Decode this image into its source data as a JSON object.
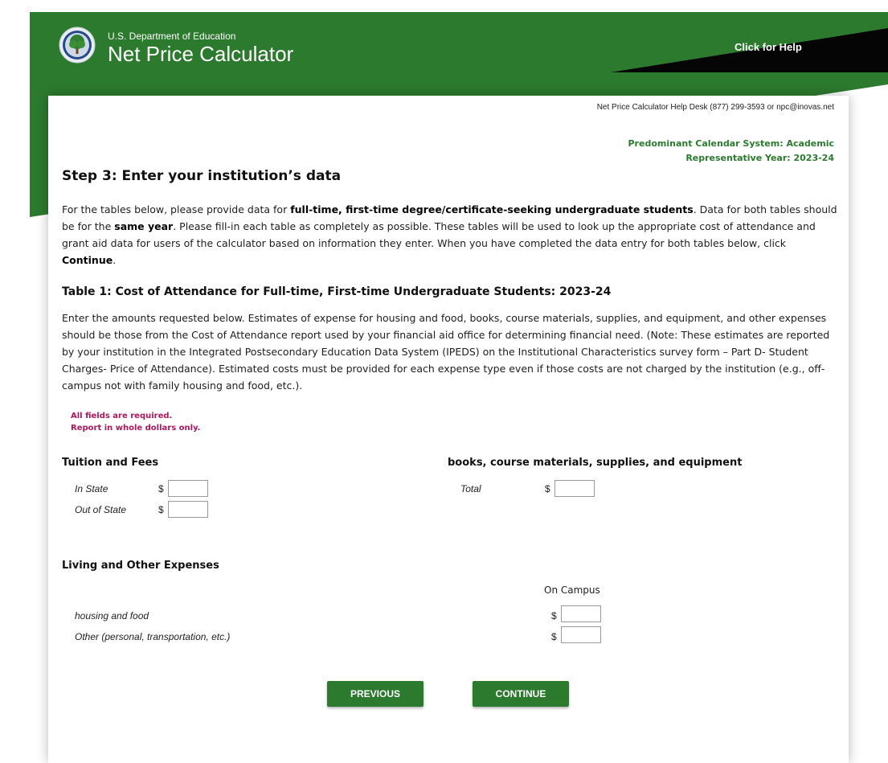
{
  "header": {
    "department": "U.S. Department of Education",
    "title": "Net Price Calculator",
    "help_link": "Click for Help"
  },
  "help_desk": "Net Price Calculator Help Desk (877) 299-3593 or npc@inovas.net",
  "calendar": {
    "system": "Predominant Calendar System: Academic",
    "year": "Representative Year: 2023-24"
  },
  "step_title": "Step 3: Enter your institution’s data",
  "intro": {
    "p1": "For the tables below, please provide data for ",
    "b1": "full-time, first-time degree/certificate-seeking undergraduate students",
    "p2": ". Data for both tables should be for the ",
    "b2": "same year",
    "p3": ". Please fill-in each table as completely as possible. These tables will be used to look up the appropriate cost of attendance and grant aid data for users of the calculator based on information they enter. When you have completed the data entry for both tables below, click ",
    "b3": "Continue",
    "p4": "."
  },
  "table1": {
    "title": "Table 1: Cost of Attendance for Full-time, First-time Undergraduate Students: 2023-24",
    "note": "Enter the amounts requested below. Estimates of expense for housing and food, books, course materials, supplies, and equipment, and other expenses should be those from the Cost of Attendance report used by your financial aid office for determining financial need. (Note: These estimates are reported by your institution in the Integrated Postsecondary Education Data System (IPEDS) on the Institutional Characteristics survey form – Part D- Student Charges- Price of Attendance). Estimated costs must be provided for each expense type even if those costs are not charged by the institution (e.g., off-campus not with family housing and food, etc.).",
    "required_line1": "All fields are required.",
    "required_line2": "Report in whole dollars only."
  },
  "tuition": {
    "heading": "Tuition and Fees",
    "in_state_label": "In State",
    "out_state_label": "Out of State",
    "currency": "$",
    "in_state_value": "",
    "out_state_value": ""
  },
  "books": {
    "heading": "books, course materials, supplies, and equipment",
    "total_label": "Total",
    "currency": "$",
    "total_value": ""
  },
  "living": {
    "heading": "Living and Other Expenses",
    "column_header": "On Campus",
    "housing_label": "housing and food",
    "other_label": "Other (personal, transportation, etc.)",
    "currency": "$",
    "housing_value": "",
    "other_value": ""
  },
  "buttons": {
    "previous": "PREVIOUS",
    "continue": "CONTINUE"
  },
  "colors": {
    "brand_green": "#2b7a2e",
    "required_text": "#b0175a"
  }
}
